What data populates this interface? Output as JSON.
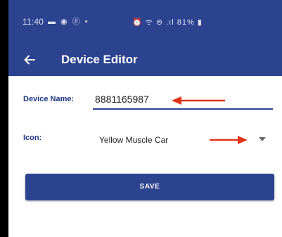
{
  "status_bar": {
    "time": "11:40",
    "left_icons": "▬ ◉ ⓟ •",
    "right_icons": "⏰ ᯤ ⊜ .ıl",
    "battery": "81%"
  },
  "app_bar": {
    "title": "Device Editor",
    "back_icon": "arrow-left"
  },
  "form": {
    "device_name_label": "Device Name:",
    "device_name_value": "8881165987",
    "icon_label": "Icon:",
    "icon_value": "Yellow Muscle Car",
    "dropdown_icon": "triangle-down"
  },
  "save": {
    "label": "SAVE"
  },
  "annotations": {
    "arrow_color": "#e0341a"
  },
  "colors": {
    "primary": "#2c4390",
    "label": "#1f3583"
  }
}
